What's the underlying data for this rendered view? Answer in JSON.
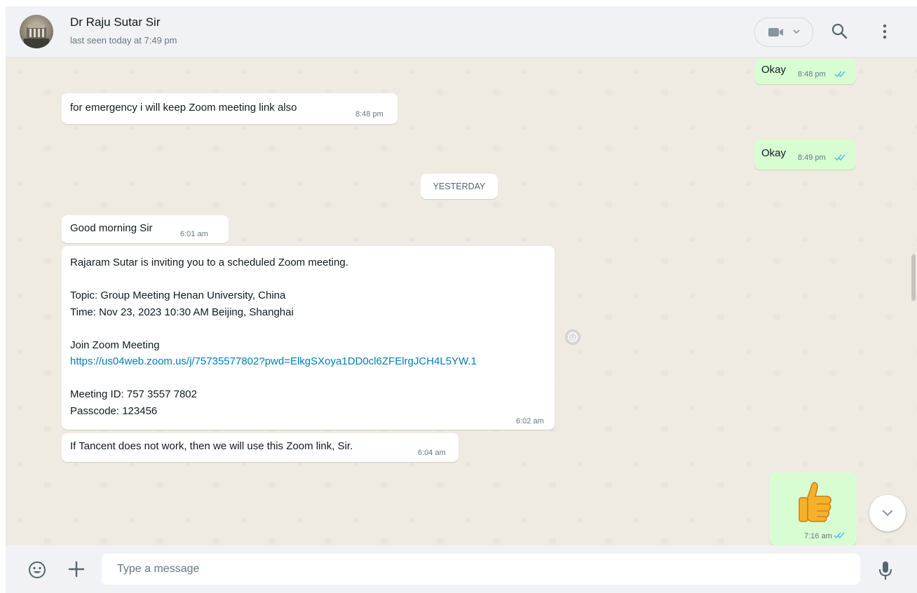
{
  "header": {
    "contact_name": "Dr Raju Sutar Sir",
    "status": "last seen today at 7:49 pm"
  },
  "messages": [
    {
      "direction": "out",
      "text": "Okay",
      "time": "8:48 pm",
      "read": true
    },
    {
      "direction": "in",
      "text": "for emergency i will keep Zoom meeting link also",
      "time": "8:48 pm"
    },
    {
      "direction": "out",
      "text": "Okay",
      "time": "8:49 pm",
      "read": true
    },
    {
      "direction": "in",
      "text": "Good morning Sir",
      "time": "6:01 am"
    },
    {
      "direction": "in",
      "lines": [
        "Rajaram Sutar is inviting you to a scheduled Zoom meeting.",
        "",
        "Topic: Group Meeting Henan University, China",
        "Time: Nov 23, 2023 10:30 AM Beijing, Shanghai",
        "",
        "Join Zoom Meeting",
        "https://us04web.zoom.us/j/75735577802?pwd=ElkgSXoya1DD0cl6ZFElrgJCH4L5YW.1",
        "",
        "Meeting ID: 757 3557 7802",
        "Passcode: 123456"
      ],
      "time": "6:02 am"
    },
    {
      "direction": "in",
      "text": "If Tancent does not work, then we will use this Zoom link, Sir.",
      "time": "6:04 am"
    },
    {
      "direction": "out",
      "emoji": "thumbs-up",
      "time": "7:16 am",
      "read": true
    }
  ],
  "date_divider": "YESTERDAY",
  "composer": {
    "placeholder": "Type a message"
  },
  "colors": {
    "chat_bg": "#efeae2",
    "outgoing_bubble": "#d9fdd3",
    "incoming_bubble": "#ffffff",
    "read_ticks": "#53bdeb",
    "link": "#027eb5"
  },
  "icons": [
    "avatar",
    "video-call-icon",
    "chevron-down-icon",
    "search-icon",
    "menu-icon",
    "reaction-icon",
    "scroll-down-icon",
    "emoji-icon",
    "plus-icon",
    "mic-icon"
  ]
}
